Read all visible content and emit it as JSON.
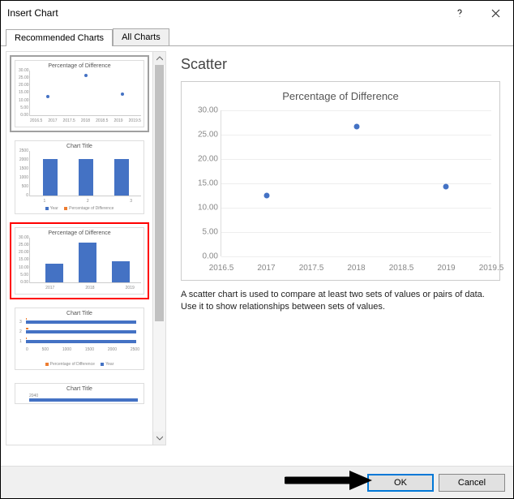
{
  "window": {
    "title": "Insert Chart",
    "help_tooltip": "Help",
    "close_tooltip": "Close"
  },
  "tabs": {
    "recommended": "Recommended Charts",
    "all": "All Charts"
  },
  "thumbnails": {
    "t1": {
      "title": "Percentage of Difference"
    },
    "t2": {
      "title": "Chart Title",
      "legend_year": "Year",
      "legend_pd": "Percentage of Difference"
    },
    "t3": {
      "title": "Percentage of Difference"
    },
    "t4": {
      "title": "Chart Title",
      "legend_pd": "Percentage of Difference",
      "legend_year": "Year"
    },
    "t5": {
      "title": "Chart Title"
    }
  },
  "preview": {
    "chart_type_label": "Scatter",
    "chart_title": "Percentage of Difference",
    "description": "A scatter chart is used to compare at least two sets of values or pairs of data. Use it to show relationships between sets of values.",
    "yticks": [
      "0.00",
      "5.00",
      "10.00",
      "15.00",
      "20.00",
      "25.00",
      "30.00"
    ],
    "xticks": [
      "2016.5",
      "2017",
      "2017.5",
      "2018",
      "2018.5",
      "2019",
      "2019.5"
    ]
  },
  "buttons": {
    "ok": "OK",
    "cancel": "Cancel"
  },
  "chart_data": {
    "type": "scatter",
    "title": "Percentage of Difference",
    "xlabel": "",
    "ylabel": "",
    "xlim": [
      2016.5,
      2019.5
    ],
    "ylim": [
      0,
      30
    ],
    "x": [
      2017,
      2018,
      2019
    ],
    "y": [
      12.5,
      26.6,
      14.3
    ]
  }
}
